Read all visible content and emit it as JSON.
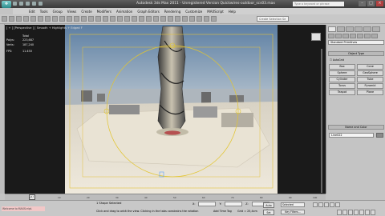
{
  "window": {
    "title": "Autodesk 3ds Max 2011 - Unregistered Version  Quickwires-outdoor_scs03.max",
    "search_placeholder": "Type a keyword or phrase"
  },
  "menu": [
    "Edit",
    "Tools",
    "Group",
    "Views",
    "Create",
    "Modifiers",
    "Animation",
    "Graph Editors",
    "Rendering",
    "Customize",
    "MAXScript",
    "Help"
  ],
  "toolbar": {
    "selection_set": "Create Selection Se"
  },
  "viewport": {
    "label": "[ + ] [Perspective ] [ Smooth + Highlights + Edged F",
    "stats": {
      "header": "Total",
      "polys_label": "Polys:",
      "polys_value": "223,687",
      "verts_label": "Verts:",
      "verts_value": "187,240",
      "fps_label": "FPS:",
      "fps_value": "11.450"
    }
  },
  "command_panel": {
    "dropdown": "Standard Primitives",
    "object_type_title": "Object Type",
    "autogrid_label": "AutoGrid",
    "buttons": [
      "Box",
      "Cone",
      "Sphere",
      "GeoSphere",
      "Cylinder",
      "Tube",
      "Torus",
      "Pyramid",
      "Teapot",
      "Plane"
    ],
    "name_color_title": "Name and Color",
    "name_value": "Line022"
  },
  "timeline": {
    "slider": "0 / 100",
    "ticks": [
      "0",
      "10",
      "20",
      "30",
      "40",
      "50",
      "60",
      "70",
      "80",
      "90",
      "100"
    ]
  },
  "status": {
    "maxscript": "Welcome to MAXScript.",
    "selection": "1 Shape Selected",
    "prompt": "Click and drag to orbit the view. Clicking in the tabs constrains the rotation",
    "x_label": "X:",
    "y_label": "Y:",
    "z_label": "Z:",
    "grid": "Grid = 25,4cm",
    "add_time_tag": "Add Time Tag",
    "auto_key": "Auto Key",
    "set_key": "Set Key",
    "selected": "Selected",
    "key_filters": "Key Filters..."
  }
}
